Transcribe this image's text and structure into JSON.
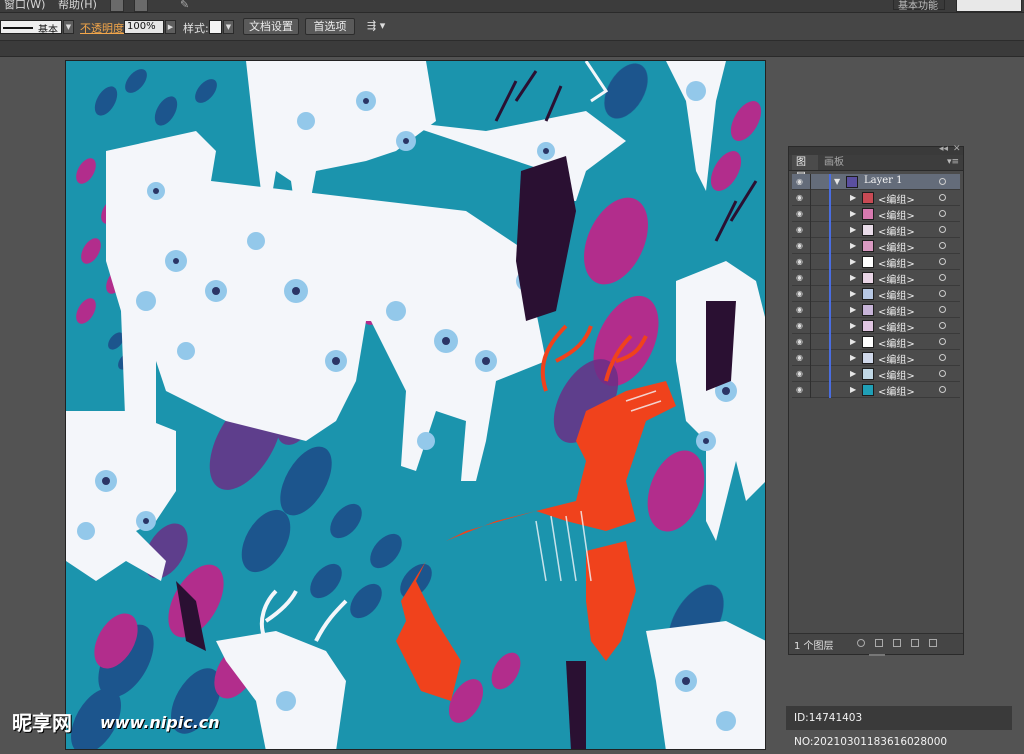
{
  "menubar": {
    "items": [
      "窗口(W)",
      "帮助(H)"
    ],
    "workspace": "基本功能",
    "search_placeholder": ""
  },
  "control_bar": {
    "stroke_label": "基本",
    "opacity_label": "不透明度",
    "opacity_value": "100%",
    "style_label": "样式:",
    "document_setup_button": "文档设置",
    "preferences_button": "首选项"
  },
  "layers_panel": {
    "tabs": [
      "图层",
      "画板"
    ],
    "active_tab": "图层",
    "layers": [
      {
        "name": "Layer 1",
        "expanded": true,
        "thumb_color": "#5a4fa0"
      },
      {
        "name": "<编组>",
        "thumb_color": "#c84a54"
      },
      {
        "name": "<编组>",
        "thumb_color": "#d77ab0"
      },
      {
        "name": "<编组>",
        "thumb_color": "#e8dbe8"
      },
      {
        "name": "<编组>",
        "thumb_color": "#d99ac2"
      },
      {
        "name": "<编组>",
        "thumb_color": "#ffffff"
      },
      {
        "name": "<编组>",
        "thumb_color": "#e9d5e6"
      },
      {
        "name": "<编组>",
        "thumb_color": "#b7c8e4"
      },
      {
        "name": "<编组>",
        "thumb_color": "#c7b4d8"
      },
      {
        "name": "<编组>",
        "thumb_color": "#e0c6e2"
      },
      {
        "name": "<编组>",
        "thumb_color": "#ffffff"
      },
      {
        "name": "<编组>",
        "thumb_color": "#d0d8ea"
      },
      {
        "name": "<编组>",
        "thumb_color": "#c1d8e6"
      },
      {
        "name": "<编组>",
        "thumb_color": "#1f9fb6"
      }
    ],
    "layer_count": "1 个图层"
  },
  "artwork": {
    "background": "#1b94ad",
    "colors": {
      "teal": "#1b94ad",
      "deep_blue": "#1e4f8a",
      "magenta": "#b22d8c",
      "purple": "#6b2f86",
      "white": "#f4f6fa",
      "light_blue": "#93c8ea",
      "navy": "#2a3566",
      "orange": "#f0421c",
      "dark": "#2a1032"
    }
  },
  "watermark": {
    "logo": "昵享网",
    "url": "www.nipic.cn",
    "id": "ID:14741403 NO:20210301183616028000"
  }
}
